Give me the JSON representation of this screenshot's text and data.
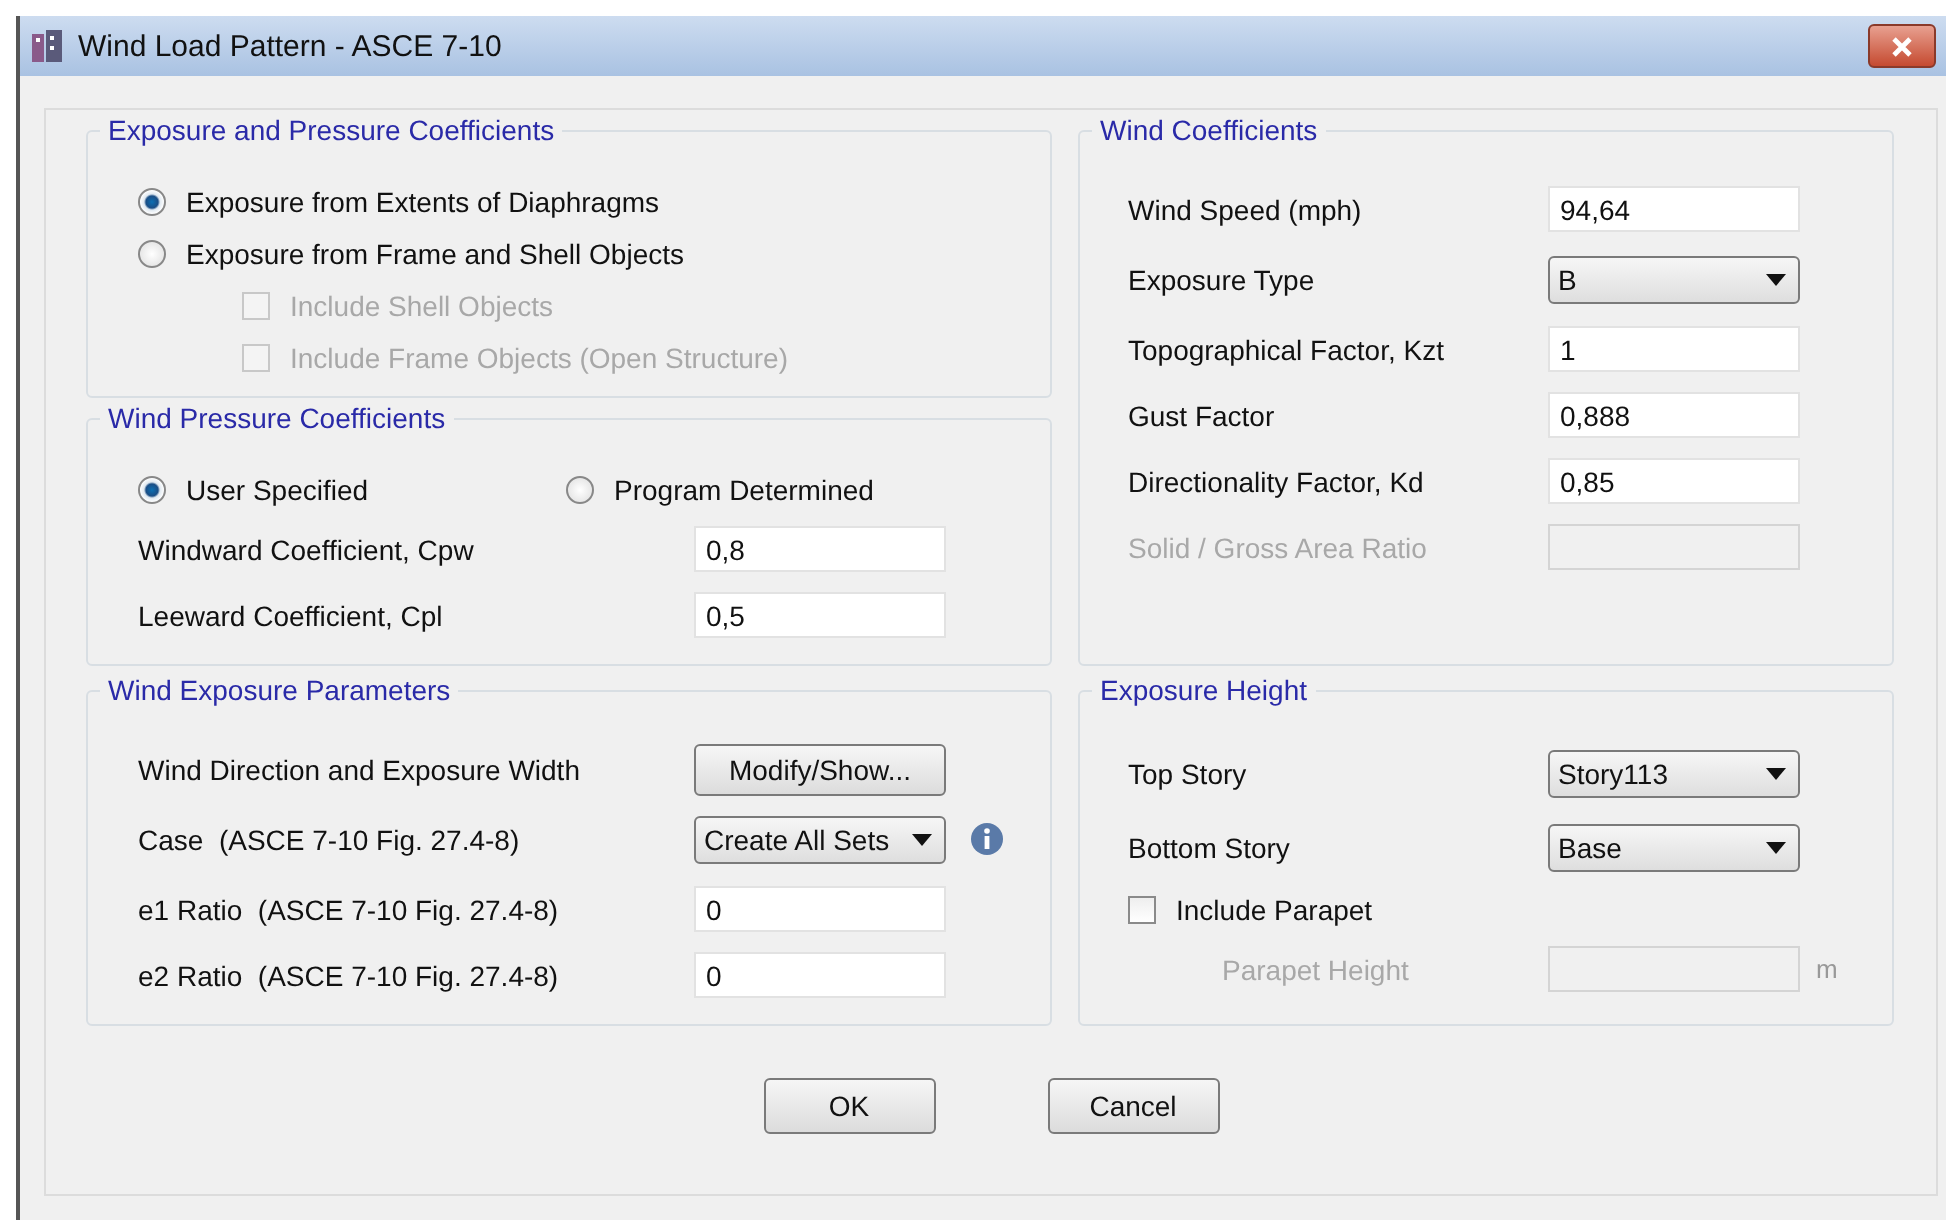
{
  "window": {
    "title": "Wind Load Pattern - ASCE 7-10"
  },
  "left_column": [
    {
      "title": "Exposure and Pressure Coefficients",
      "rows": [
        {
          "kind": "radio",
          "label": "Exposure from Extents of Diaphragms",
          "selected": true
        },
        {
          "kind": "radio",
          "label": "Exposure from Frame and Shell Objects",
          "selected": false,
          "children": [
            {
              "kind": "checkbox",
              "label": "Include Shell Objects",
              "checked": false,
              "disabled": true
            },
            {
              "kind": "checkbox",
              "label": "Include Frame Objects (Open Structure)",
              "checked": false,
              "disabled": true
            }
          ]
        }
      ]
    },
    {
      "title": "Wind Pressure Coefficients",
      "rows": [
        {
          "kind": "radio_pair",
          "options": [
            {
              "label": "User Specified",
              "selected": true
            },
            {
              "label": "Program Determined",
              "selected": false
            }
          ]
        },
        {
          "kind": "field",
          "label": "Windward Coefficient, Cpw",
          "value": "0,8",
          "disabled": false
        },
        {
          "kind": "field",
          "label": "Leeward Coefficient, Cpl",
          "value": "0,5",
          "disabled": false
        }
      ]
    },
    {
      "title": "Wind Exposure Parameters",
      "rows": [
        {
          "kind": "button",
          "label": "Wind Direction and Exposure Width",
          "button": "Modify/Show..."
        },
        {
          "kind": "dropdown",
          "label": "Case  (ASCE 7-10 Fig. 27.4-8)",
          "value": "Create All Sets",
          "info_icon": true
        },
        {
          "kind": "field",
          "label": "e1 Ratio  (ASCE 7-10 Fig. 27.4-8)",
          "value": "0",
          "disabled": false
        },
        {
          "kind": "field",
          "label": "e2 Ratio  (ASCE 7-10 Fig. 27.4-8)",
          "value": "0",
          "disabled": false
        }
      ]
    }
  ],
  "right_column": [
    {
      "title": "Wind Coefficients",
      "rows": [
        {
          "kind": "field",
          "label": "Wind Speed (mph)",
          "value": "94,64",
          "disabled": false
        },
        {
          "kind": "dropdown",
          "label": "Exposure Type",
          "value": "B",
          "info_icon": false
        },
        {
          "kind": "field",
          "label": "Topographical Factor, Kzt",
          "value": "1",
          "disabled": false
        },
        {
          "kind": "field",
          "label": "Gust Factor",
          "value": "0,888",
          "disabled": false
        },
        {
          "kind": "field",
          "label": "Directionality Factor, Kd",
          "value": "0,85",
          "disabled": false
        },
        {
          "kind": "field",
          "label": "Solid / Gross Area Ratio",
          "disabled": true
        }
      ]
    },
    {
      "title": "Exposure Height",
      "rows": [
        {
          "kind": "dropdown",
          "label": "Top Story",
          "value": "Story113",
          "info_icon": false
        },
        {
          "kind": "dropdown",
          "label": "Bottom Story",
          "value": "Base",
          "info_icon": false
        },
        {
          "kind": "checkbox",
          "label": "Include Parapet",
          "checked": false,
          "disabled": false,
          "children": [
            {
              "kind": "field",
              "label": "Parapet Height",
              "disabled": true,
              "unit": "m"
            }
          ]
        }
      ]
    }
  ],
  "buttons": [
    "OK",
    "Cancel"
  ]
}
